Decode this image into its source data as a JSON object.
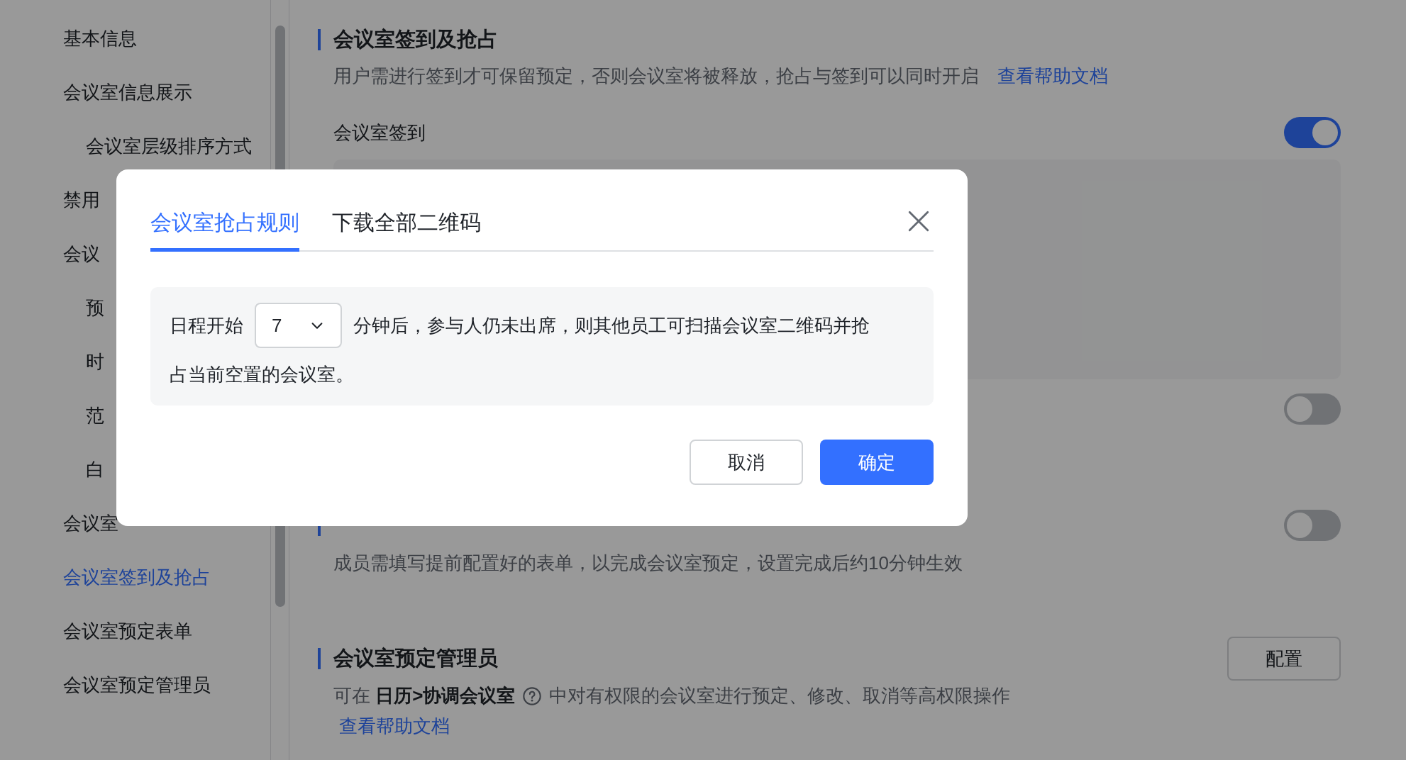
{
  "sidebar": {
    "items": [
      {
        "label": "基本信息",
        "selected": false
      },
      {
        "label": "会议室信息展示",
        "selected": false,
        "children": [
          {
            "label": "会议室层级排序方式",
            "selected": false
          }
        ]
      },
      {
        "label": "禁用",
        "selected": false
      },
      {
        "label": "会议",
        "selected": false,
        "children": [
          {
            "label": "预",
            "selected": false
          },
          {
            "label": "时",
            "selected": false
          },
          {
            "label": "范",
            "selected": false
          },
          {
            "label": "白",
            "selected": false
          }
        ]
      },
      {
        "label": "会议室",
        "selected": false
      },
      {
        "label": "会议室签到及抢占",
        "selected": true
      },
      {
        "label": "会议室预定表单",
        "selected": false
      },
      {
        "label": "会议室预定管理员",
        "selected": false
      }
    ]
  },
  "sections": [
    {
      "kind": "checkin",
      "title": "会议室签到及抢占",
      "description": "用户需进行签到才可保留预定，否则会议室将被释放，抢占与签到可以同时开启",
      "link": "查看帮助文档",
      "switches": [
        {
          "label": "会议室签到",
          "on": true
        },
        {
          "on": false
        }
      ]
    },
    {
      "kind": "form",
      "description": "成员需填写提前配置好的表单，以完成会议室预定，设置完成后约10分钟生效",
      "switch_on": false
    },
    {
      "kind": "admin",
      "title": "会议室预定管理员",
      "description_before": "可在 **日历>协调会议室**",
      "description_after": "中对有权限的会议室进行预定、修改、取消等高权限操作",
      "link": "查看帮助文档",
      "button": "配置"
    }
  ],
  "dialog": {
    "tabs": [
      {
        "label": "会议室抢占规则",
        "selected": true
      },
      {
        "label": "下载全部二维码",
        "selected": false
      }
    ],
    "rule_before": "日程开始",
    "minutes": "7",
    "rule_after": "分钟后，参与人仍未出席，则其他员工可扫描会议室二维码并抢",
    "rule_continued": "占当前空置的会议室。",
    "buttons": [
      {
        "label": "取消",
        "kind": "secondary"
      },
      {
        "label": "确定",
        "kind": "primary"
      }
    ]
  }
}
